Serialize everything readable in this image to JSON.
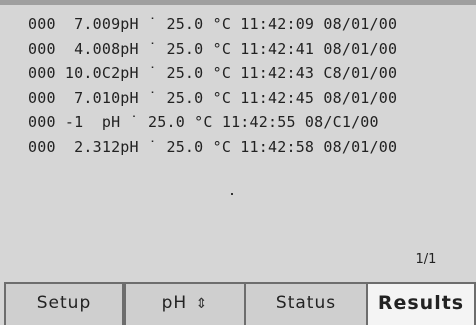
{
  "log": {
    "rows": [
      "000  7.009pH ˙ 25.0 °C 11:42:09 08/01/00",
      "000  4.008pH ˙ 25.0 °C 11:42:41 08/01/00",
      "000 10.0C2pH ˙ 25.0 °C 11:42:43 C8/01/00",
      "000  7.010pH ˙ 25.0 °C 11:42:45 08/01/00",
      "000 -1  pH ˙ 25.0 °C 11:42:55 08/C1/00",
      "000  2.312pH ˙ 25.0 °C 11:42:58 08/01/00"
    ]
  },
  "page_indicator": "1/1",
  "tabs": {
    "setup": "Setup",
    "ph": "pH",
    "ph_icon": "up-down-arrow-icon",
    "status": "Status",
    "results": "Results"
  }
}
